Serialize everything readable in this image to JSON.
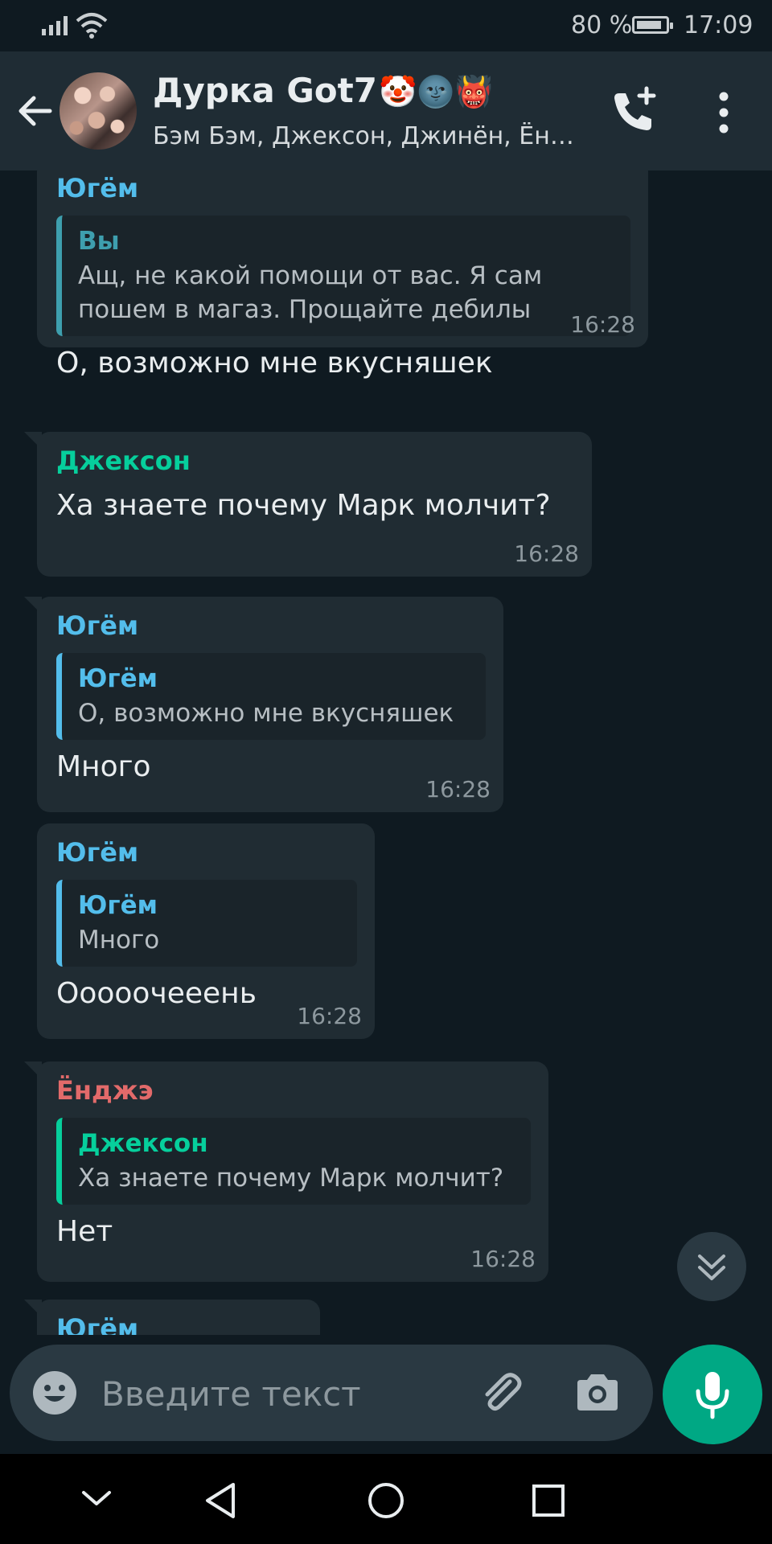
{
  "status_bar": {
    "battery": "80 %",
    "time": "17:09"
  },
  "header": {
    "title": "Дурка Got7",
    "title_emojis": "🤡🌚👹",
    "subtitle": "Бэм Бэм, Джексон, Джинён, Ён…"
  },
  "messages": [
    {
      "sender": "Югём",
      "sender_color": "#53bdeb",
      "quote": {
        "sender": "Вы",
        "sender_color": "#3e9fae",
        "text": "Ащ, не какой помощи от вас. Я сам пошем в магаз. Прощайте дебилы"
      },
      "text": "О,  возможно мне вкусняшек",
      "time": "16:28"
    },
    {
      "sender": "Джексон",
      "sender_color": "#06cf9c",
      "text": "Ха знаете почему Марк молчит?",
      "time": "16:28"
    },
    {
      "sender": "Югём",
      "sender_color": "#53bdeb",
      "quote": {
        "sender": "Югём",
        "sender_color": "#53bdeb",
        "text": "О,  возможно мне вкусняшек"
      },
      "text": "Много",
      "time": "16:28"
    },
    {
      "sender": "Югём",
      "sender_color": "#53bdeb",
      "quote": {
        "sender": "Югём",
        "sender_color": "#53bdeb",
        "text": "Много"
      },
      "text": "Ооооочееень",
      "time": "16:28"
    },
    {
      "sender": "Ёнджэ",
      "sender_color": "#e26a6a",
      "quote": {
        "sender": "Джексон",
        "sender_color": "#06cf9c",
        "text": "Ха знаете почему Марк молчит?"
      },
      "text": "Нет",
      "time": "16:28"
    },
    {
      "sender": "Югём",
      "sender_color": "#53bdeb"
    }
  ],
  "composer": {
    "placeholder": "Введите текст"
  },
  "icons": {
    "back": "arrow-left-icon",
    "call": "add-call-icon",
    "menu": "more-vert-icon",
    "emoji": "emoji-icon",
    "attach": "paperclip-icon",
    "camera": "camera-icon",
    "mic": "mic-icon",
    "scroll": "double-chevron-down-icon"
  },
  "colors": {
    "accent": "#00a884",
    "bubble": "#202c33",
    "background": "#0f1a21"
  }
}
